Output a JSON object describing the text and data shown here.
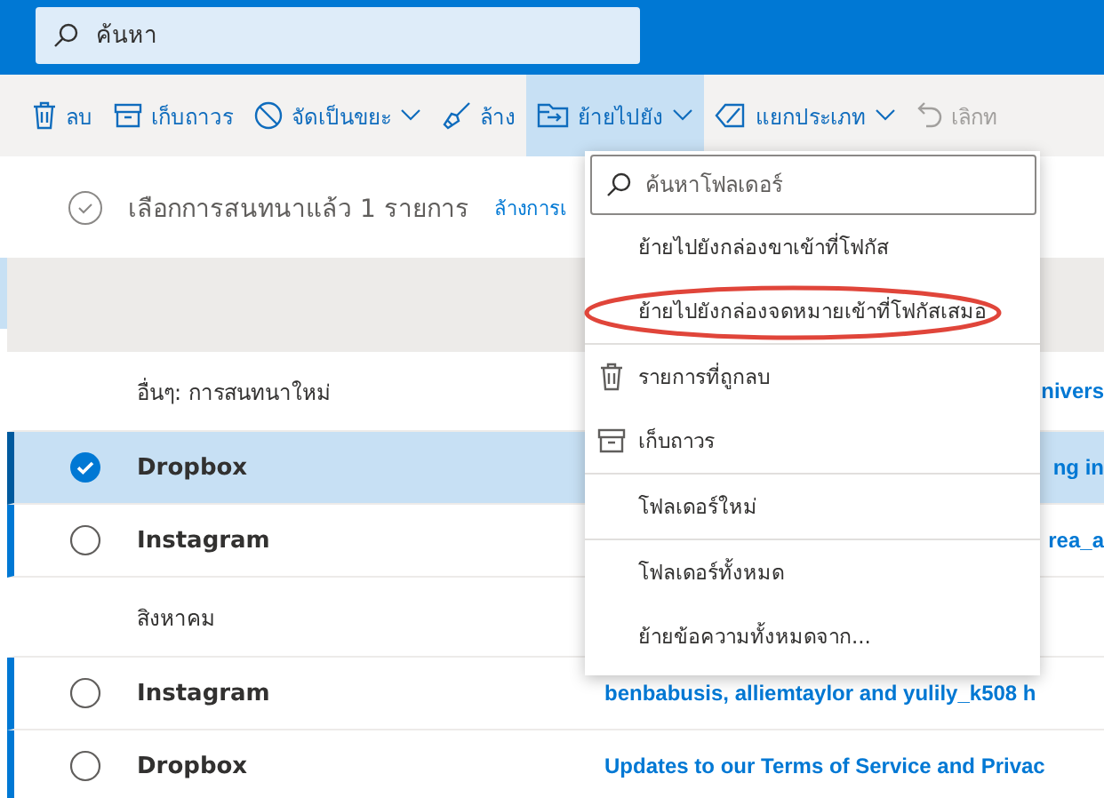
{
  "search": {
    "placeholder": "ค้นหา"
  },
  "toolbar": [
    {
      "kind": "delete",
      "label": "ลบ",
      "has_menu": false,
      "selected": false,
      "disabled": false
    },
    {
      "kind": "archive",
      "label": "เก็บถาวร",
      "has_menu": false,
      "selected": false,
      "disabled": false
    },
    {
      "kind": "junk",
      "label": "จัดเป็นขยะ",
      "has_menu": true,
      "selected": false,
      "disabled": false
    },
    {
      "kind": "sweep",
      "label": "ล้าง",
      "has_menu": false,
      "selected": false,
      "disabled": false
    },
    {
      "kind": "move",
      "label": "ย้ายไปยัง",
      "has_menu": true,
      "selected": true,
      "disabled": false
    },
    {
      "kind": "categorize",
      "label": "แยกประเภท",
      "has_menu": true,
      "selected": false,
      "disabled": false
    },
    {
      "kind": "undo",
      "label": "เลิกท",
      "has_menu": false,
      "selected": false,
      "disabled": true
    }
  ],
  "selection_bar": {
    "text": "เลือกการสนทนาแล้ว 1 รายการ",
    "link": "ล้างการเ"
  },
  "messages": [
    {
      "kind": "group",
      "label": "อื่นๆ: การสนทนาใหม่",
      "preview": "nivers",
      "clipped": true
    },
    {
      "kind": "message",
      "sender": "Dropbox",
      "selected": true,
      "preview": "ng in",
      "clipped": true
    },
    {
      "kind": "message",
      "sender": "Instagram",
      "selected": false,
      "preview": "rea_a",
      "clipped": true
    },
    {
      "kind": "group",
      "label": "สิงหาคม"
    },
    {
      "kind": "message",
      "sender": "Instagram",
      "selected": false,
      "preview": "benbabusis, alliemtaylor and yulily_k508 h",
      "clipped": false
    },
    {
      "kind": "message",
      "sender": "Dropbox",
      "selected": false,
      "preview": "Updates to our Terms of Service and Privac",
      "clipped": false
    }
  ],
  "move_menu": {
    "search": {
      "placeholder": "ค้นหาโฟลเดอร์"
    },
    "items": [
      {
        "kind": "plain",
        "label": "ย้ายไปยังกล่องขาเข้าที่โฟกัส",
        "divider_before": false,
        "circled": false
      },
      {
        "kind": "plain",
        "label": "ย้ายไปยังกล่องจดหมายเข้าที่โฟกัสเสมอ",
        "divider_before": false,
        "circled": true
      },
      {
        "kind": "trash",
        "label": "รายการที่ถูกลบ",
        "divider_before": true,
        "circled": false
      },
      {
        "kind": "archive",
        "label": "เก็บถาวร",
        "divider_before": false,
        "circled": false
      },
      {
        "kind": "plain",
        "label": "โฟลเดอร์ใหม่",
        "divider_before": true,
        "circled": false
      },
      {
        "kind": "plain",
        "label": "โฟลเดอร์ทั้งหมด",
        "divider_before": true,
        "circled": false
      },
      {
        "kind": "plain",
        "label": "ย้ายข้อความทั้งหมดจาก...",
        "divider_before": false,
        "circled": false
      }
    ]
  }
}
